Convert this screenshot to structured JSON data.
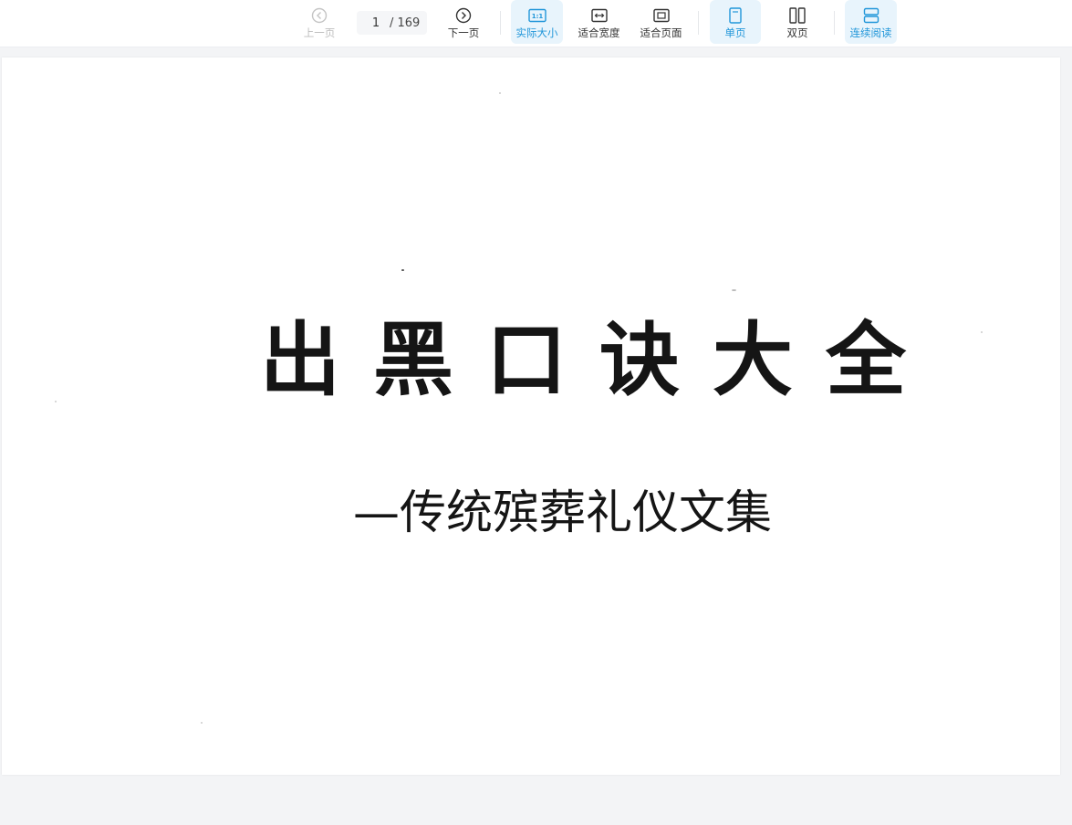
{
  "toolbar": {
    "prev_label": "上一页",
    "next_label": "下一页",
    "current_page": "1",
    "total_pages": "/ 169",
    "actual_size_label": "实际大小",
    "actual_size_badge": "1:1",
    "fit_width_label": "适合宽度",
    "fit_page_label": "适合页面",
    "single_page_label": "单页",
    "double_page_label": "双页",
    "continuous_label": "连续阅读"
  },
  "colors": {
    "accent": "#2196d9",
    "active_bg": "#e8f4fc",
    "disabled": "#bdbdbd"
  },
  "document": {
    "title": "出黑口诀大全",
    "subtitle": "—传统殡葬礼仪文集"
  }
}
